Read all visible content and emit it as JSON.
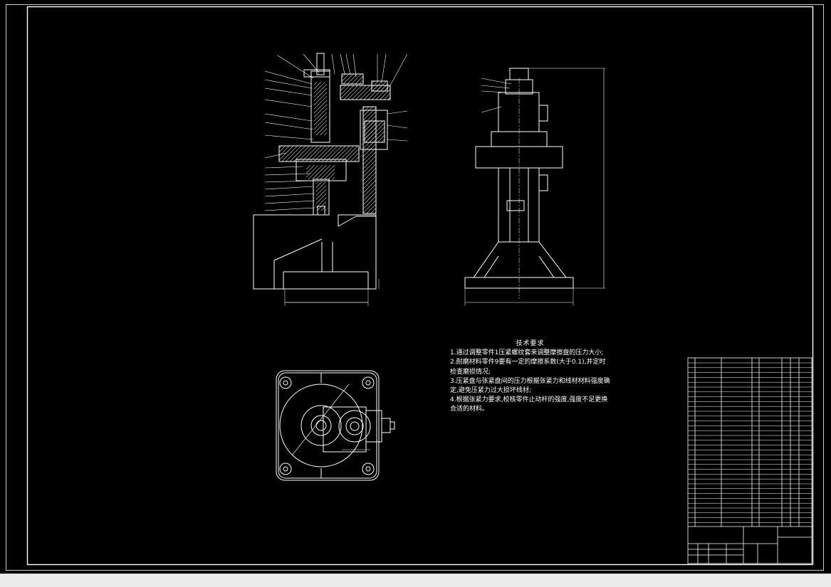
{
  "technical_requirements": {
    "title": "技术要求",
    "items": [
      "1.通过调整零件1压紧螺纹套来调整摩擦盘的压力大小;",
      "2.耐磨材料零件9要有一定的摩擦系数(大于0.1),并定时检查磨损情况;",
      "3.压紧盘与张紧盘间的压力根据张紧力和线材材料强度确定,避免压紧力过大损坏线材;",
      "4.根据张紧力要求,校核零件止动杆的强度,强度不足更换合适的材料。"
    ]
  },
  "colors": {
    "background": "#000000",
    "linework": "#ffffff",
    "status_bar": "#ececec"
  }
}
